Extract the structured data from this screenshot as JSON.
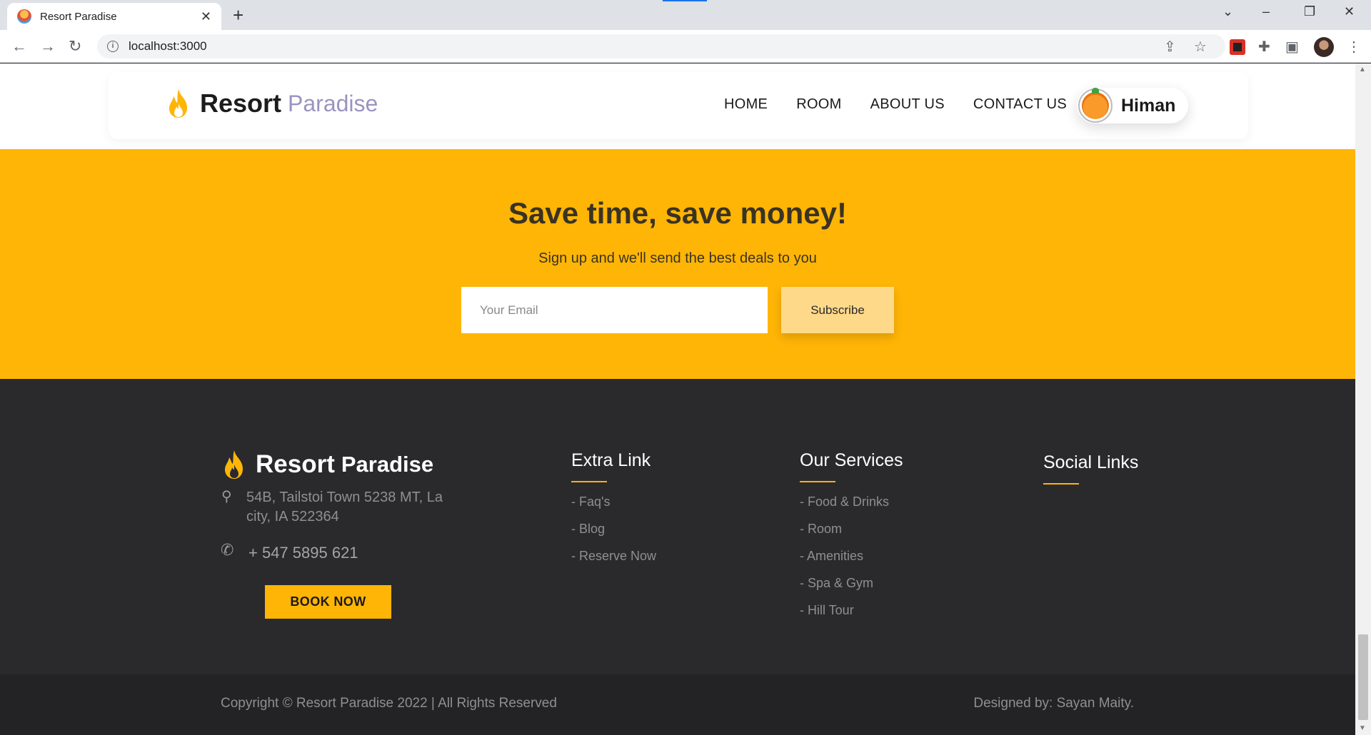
{
  "browser": {
    "tab_title": "Resort Paradise",
    "tab_close": "✕",
    "new_tab": "+",
    "url": "localhost:3000",
    "icons": [
      "back-icon",
      "forward-icon",
      "reload-icon",
      "share-icon",
      "star-icon",
      "extensions-icon",
      "sidepanel-icon",
      "menu-icon"
    ]
  },
  "nav": {
    "brand_main": "Resort",
    "brand_sub": "Paradise",
    "links": [
      "HOME",
      "ROOM",
      "ABOUT US",
      "CONTACT US"
    ],
    "user_name": "Himan"
  },
  "promo": {
    "title": "Save time, save money!",
    "subtitle": "Sign up and we'll send the best deals to you",
    "email_placeholder": "Your Email",
    "subscribe_label": "Subscribe"
  },
  "footer": {
    "brand_main": "Resort",
    "brand_sub": "Paradise",
    "address": "54B, Tailstoi Town 5238 MT, La city, IA 522364",
    "phone": "+ 547 5895 621",
    "book_label": "BOOK NOW",
    "extra": {
      "title": "Extra Link",
      "items": [
        "- Faq's",
        "- Blog",
        "- Reserve Now"
      ]
    },
    "services": {
      "title": "Our Services",
      "items": [
        "- Food & Drinks",
        "- Room",
        "- Amenities",
        "- Spa & Gym",
        "- Hill Tour"
      ]
    },
    "social": {
      "title": "Social Links"
    },
    "copyright": "Copyright © Resort Paradise 2022 | All Rights Reserved",
    "designer": "Designed by: Sayan Maity."
  },
  "colors": {
    "accent": "#ffb506",
    "footer_bg": "#2a2a2d",
    "brand_sub": "#9a94c0"
  }
}
